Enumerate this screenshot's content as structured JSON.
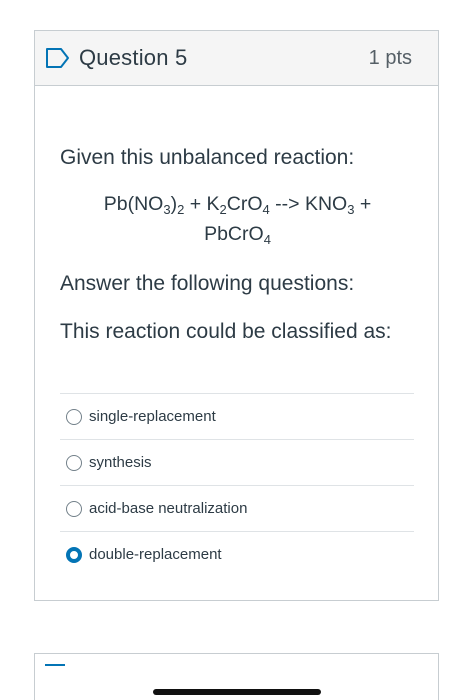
{
  "question": {
    "title": "Question 5",
    "points": "1 pts",
    "flag_icon": "bookmark-flag-icon",
    "accent_color": "#0374b5"
  },
  "body": {
    "intro": "Given this unbalanced reaction:",
    "reaction": {
      "pb": "Pb(NO",
      "sub_3a": "3",
      "paren": ")",
      "sub_2": "2",
      "plus_k": " + K",
      "sub_2b": "2",
      "cro": "CrO",
      "sub_4a": "4",
      "arrow": " --> KNO",
      "sub_3b": "3",
      "plus": " +",
      "pbcro": "PbCrO",
      "sub_4b": "4"
    },
    "instruction": "Answer the following questions:",
    "prompt": "This reaction could be classified as:"
  },
  "answers": [
    {
      "label": "single-replacement",
      "selected": false
    },
    {
      "label": "synthesis",
      "selected": false
    },
    {
      "label": "acid-base neutralization",
      "selected": false
    },
    {
      "label": "double-replacement",
      "selected": true
    }
  ]
}
